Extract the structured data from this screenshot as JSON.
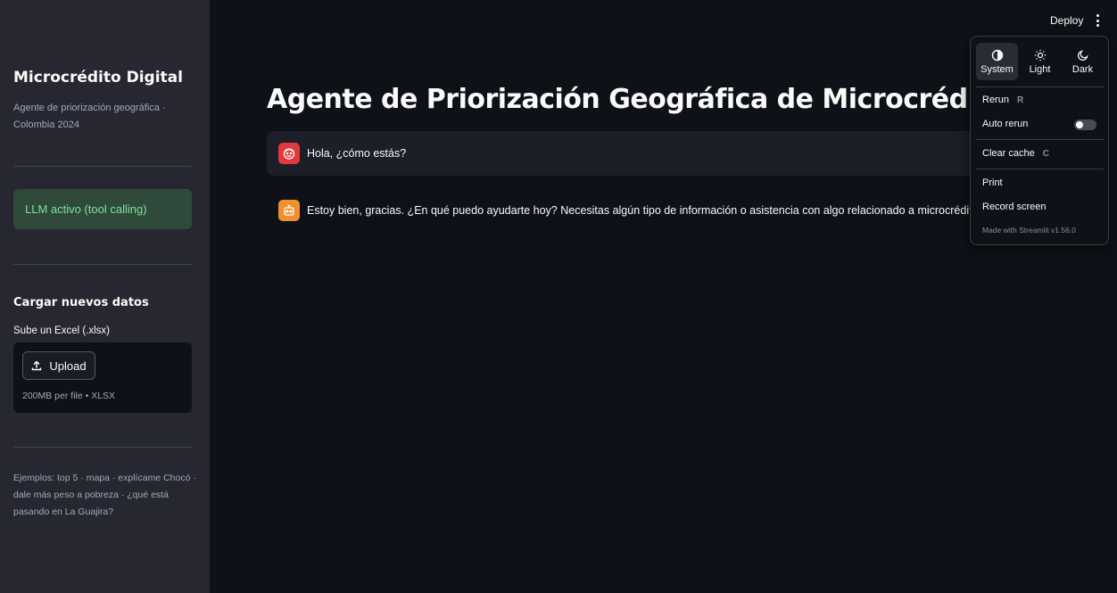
{
  "sidebar": {
    "title": "Microcrédito Digital",
    "caption": "Agente de priorización geográfica · Colombia 2024",
    "llm_status": "LLM activo (tool calling)",
    "upload_section_title": "Cargar nuevos datos",
    "upload_label": "Sube un Excel (.xlsx)",
    "upload_button": "Upload",
    "upload_note": "200MB per file • XLSX",
    "examples": "Ejemplos: top 5 · mapa · explícame Chocó · dale más peso a pobreza · ¿qué está pasando en La Guajira?"
  },
  "topbar": {
    "deploy_label": "Deploy"
  },
  "main": {
    "title": "Agente de Priorización Geográfica de Microcrédito",
    "messages": [
      {
        "role": "user",
        "text": "Hola, ¿cómo estás?"
      },
      {
        "role": "assistant",
        "text": "Estoy bien, gracias. ¿En qué puedo ayudarte hoy? Necesitas algún tipo de información o asistencia con algo relacionado a microcrédito digital"
      }
    ]
  },
  "menu": {
    "themes": [
      {
        "label": "System",
        "icon": "contrast-icon",
        "active": true
      },
      {
        "label": "Light",
        "icon": "sun-icon",
        "active": false
      },
      {
        "label": "Dark",
        "icon": "moon-icon",
        "active": false
      }
    ],
    "rerun": {
      "label": "Rerun",
      "shortcut": "R"
    },
    "auto_rerun": {
      "label": "Auto rerun",
      "enabled": false
    },
    "clear_cache": {
      "label": "Clear cache",
      "shortcut": "C"
    },
    "print": "Print",
    "record_screen": "Record screen",
    "made_with": "Made with Streamlit v1.56.0"
  },
  "colors": {
    "background": "#0e1117",
    "sidebar": "#262730",
    "success_bg": "#2f4a3a",
    "success_text": "#7fe09a",
    "user_avatar": "#e0393e",
    "bot_avatar": "#f0902e"
  }
}
